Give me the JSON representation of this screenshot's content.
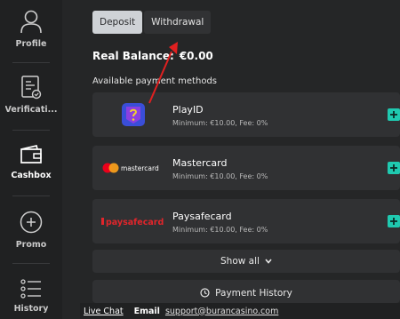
{
  "sidebar": {
    "items": [
      {
        "label": "Profile",
        "icon": "user-icon"
      },
      {
        "label": "Verificati...",
        "icon": "verification-document-icon"
      },
      {
        "label": "Cashbox",
        "icon": "wallet-icon"
      },
      {
        "label": "Promo",
        "icon": "plus-circle-icon"
      },
      {
        "label": "History",
        "icon": "history-list-icon"
      }
    ]
  },
  "tabs": [
    {
      "label": "Deposit",
      "active": true
    },
    {
      "label": "Withdrawal",
      "active": false
    }
  ],
  "balance": {
    "label": "Real Balance:",
    "value": "€0.00"
  },
  "methods": {
    "title": "Available payment methods",
    "items": [
      {
        "name": "PlayID",
        "info": "Minimum: €10.00, Fee: 0%",
        "logo": "playid-logo"
      },
      {
        "name": "Mastercard",
        "info": "Minimum: €10.00, Fee: 0%",
        "logo": "mastercard-logo",
        "logo_text": "mastercard"
      },
      {
        "name": "Paysafecard",
        "info": "Minimum: €10.00, Fee: 0%",
        "logo": "paysafecard-logo",
        "logo_text": "paysafecard"
      }
    ]
  },
  "show_all": "Show all",
  "payment_history": "Payment History",
  "footer": {
    "live_chat": "Live Chat",
    "email_label": "Email",
    "email": "support@burancasino.com"
  },
  "colors": {
    "background": "#252627",
    "sidebar": "#202122",
    "card": "#303133",
    "accent_add": "#1fc9b0",
    "annotation_arrow": "#e02020"
  }
}
